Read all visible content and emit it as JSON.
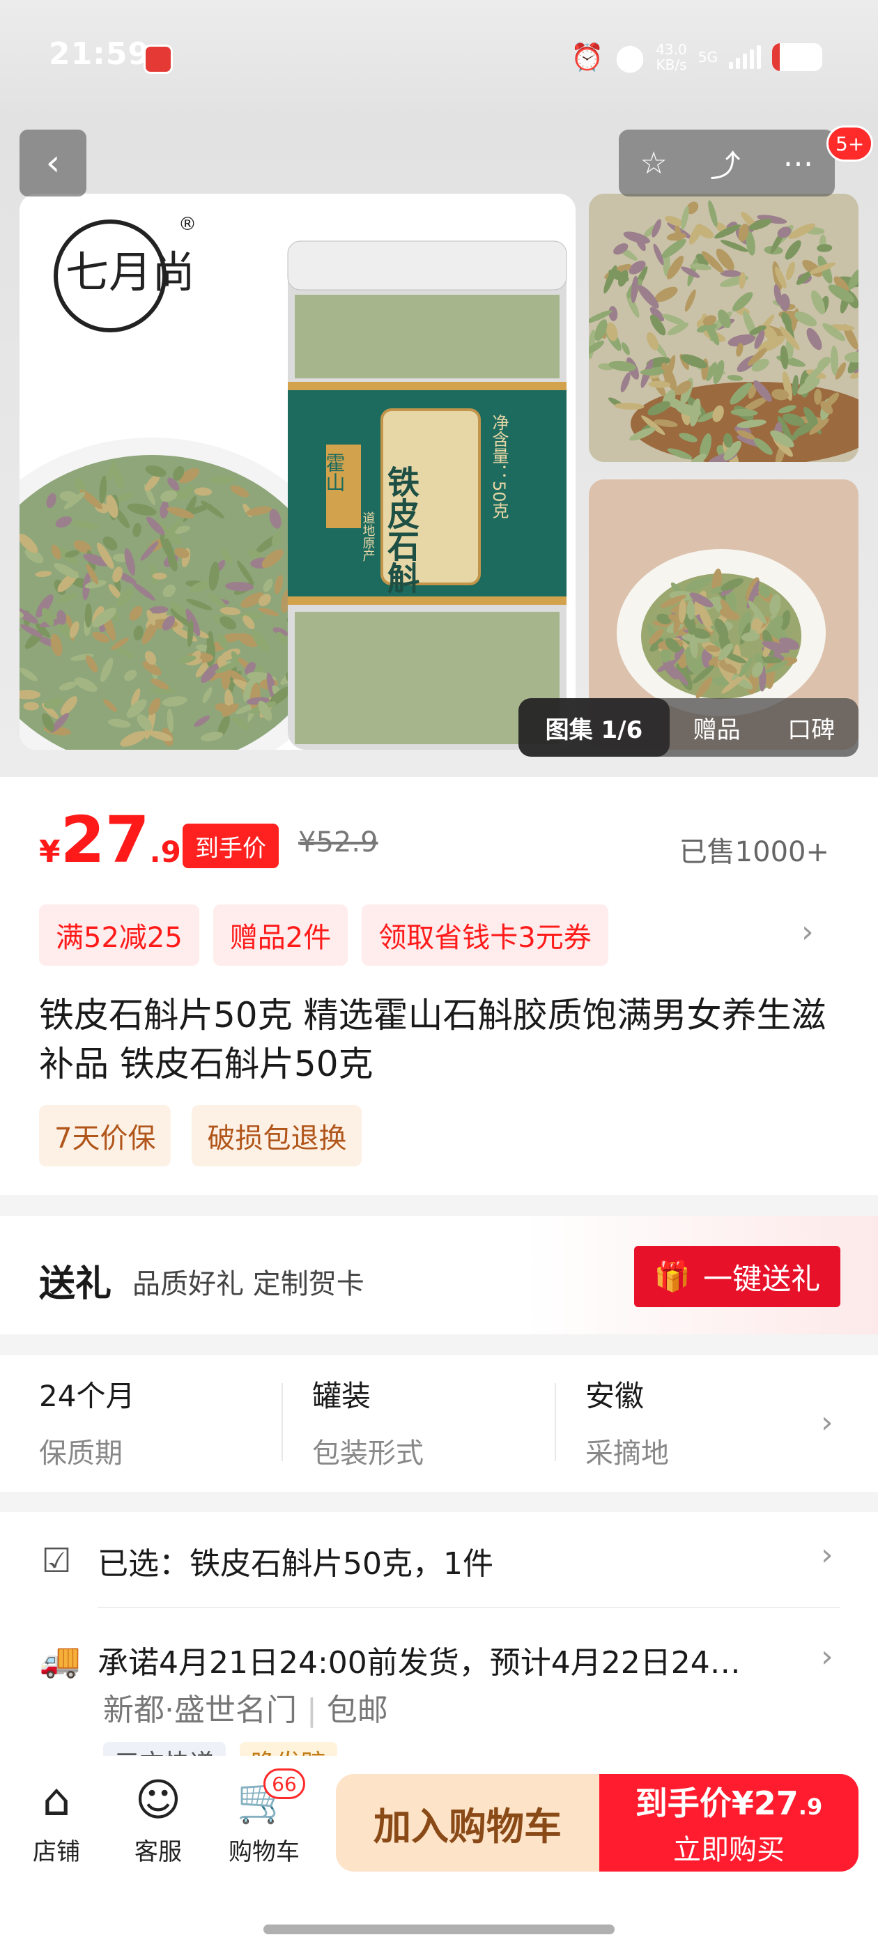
{
  "status_bar": {
    "time": "21:59",
    "net_speed_value": "43.0",
    "net_speed_unit": "KB/s",
    "network": "5G",
    "battery_level": 0.15,
    "icons": [
      "alarm-icon",
      "location-icon",
      "signal-icon",
      "battery-icon"
    ]
  },
  "gallery": {
    "brand_logo": "七月尚",
    "jar_label_main": "铁皮石斛",
    "jar_label_side": "霍山",
    "jar_label_sub": "道地原产",
    "jar_label_net": "净含量：50克",
    "tabs": [
      "图集 1/6",
      "赠品",
      "口碑"
    ],
    "active_tab": 0,
    "notification_badge": "5+",
    "icons": [
      "back-icon",
      "star-icon",
      "share-icon",
      "more-icon"
    ]
  },
  "price": {
    "currency": "¥",
    "integer": "27",
    "decimal": ".9",
    "tag": "到手价",
    "original": "¥52.9",
    "sold": "已售1000+"
  },
  "promos": [
    "满52减25",
    "赠品2件",
    "领取省钱卡3元券"
  ],
  "product": {
    "title": "铁皮石斛片50克 精选霍山石斛胶质饱满男女养生滋补品 铁皮石斛片50克"
  },
  "services": [
    "7天价保",
    "破损包退换"
  ],
  "gift": {
    "title": "送礼",
    "subtitle": "品质好礼 定制贺卡",
    "button": "一键送礼"
  },
  "specs": [
    {
      "value": "24个月",
      "label": "保质期"
    },
    {
      "value": "罐装",
      "label": "包装形式"
    },
    {
      "value": "安徽",
      "label": "采摘地"
    }
  ],
  "selection": {
    "text": "已选：铁皮石斛片50克，1件"
  },
  "shipping": {
    "text": "承诺4月21日24:00前发货，预计4月22日24…",
    "location": "新都·盛世名门",
    "free": "包邮",
    "tags": [
      "三方快递",
      "晚发赔"
    ]
  },
  "bottom_bar": {
    "store": "店铺",
    "service": "客服",
    "cart": "购物车",
    "cart_count": "66",
    "add_cart": "加入购物车",
    "buy_price_label": "到手价",
    "buy_price_currency": "¥",
    "buy_price_int": "27",
    "buy_price_dec": ".9",
    "buy_label": "立即购买"
  },
  "colors": {
    "accent_red": "#ff1a1a",
    "promo_bg": "#ffecec",
    "service_bg": "#fdf1e6",
    "add_cart_bg": "#fde3c8"
  }
}
